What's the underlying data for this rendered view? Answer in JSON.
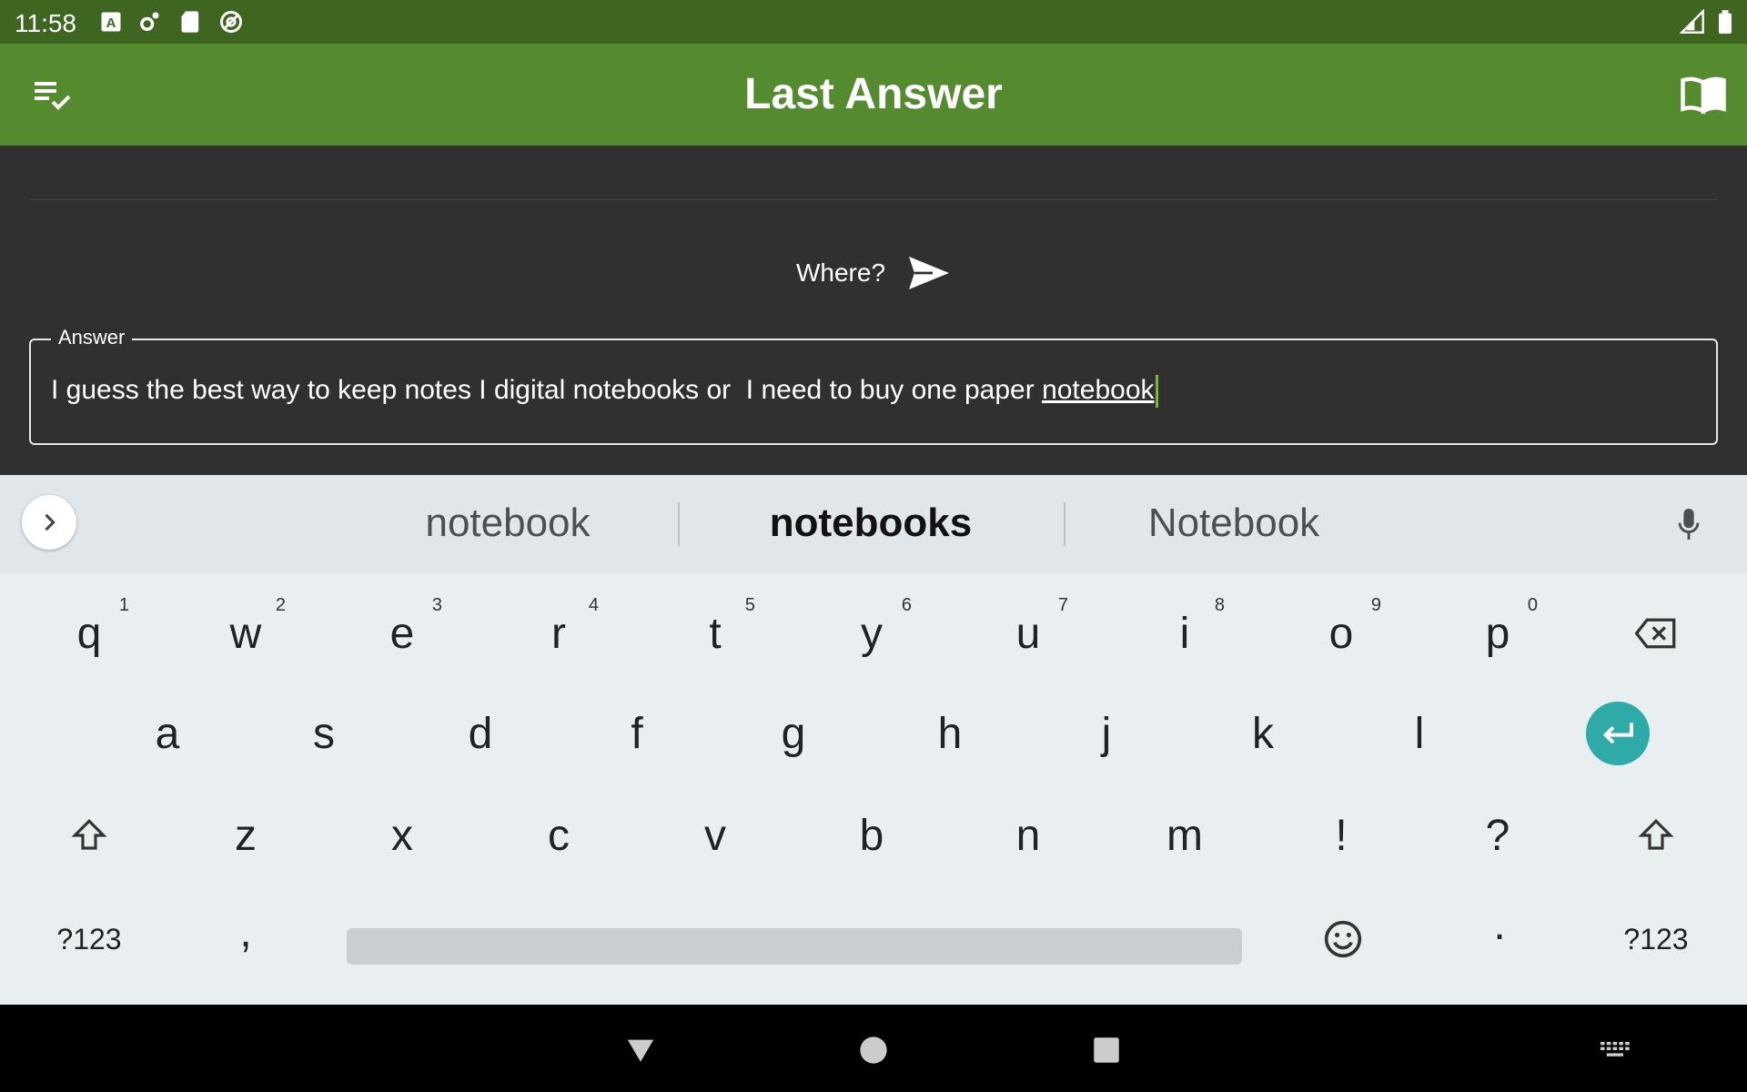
{
  "status_bar": {
    "time": "11:58",
    "icons": [
      "a-box-icon",
      "settings-gear-icon",
      "sd-card-icon",
      "at-sign-icon",
      "signal-icon",
      "battery-icon"
    ]
  },
  "app_bar": {
    "title": "Last Answer",
    "left_icon": "playlist-check-icon",
    "right_icon": "book-icon",
    "background": "#558b2f"
  },
  "content": {
    "question": "Where?",
    "field_label": "Answer",
    "answer_before": "I guess the best way to keep notes I digital notebooks or  I need to buy one paper ",
    "answer_composing": "notebook"
  },
  "keyboard": {
    "suggestions": [
      "notebook",
      "notebooks",
      "Notebook"
    ],
    "row1": [
      {
        "key": "q",
        "hint": "1"
      },
      {
        "key": "w",
        "hint": "2"
      },
      {
        "key": "e",
        "hint": "3"
      },
      {
        "key": "r",
        "hint": "4"
      },
      {
        "key": "t",
        "hint": "5"
      },
      {
        "key": "y",
        "hint": "6"
      },
      {
        "key": "u",
        "hint": "7"
      },
      {
        "key": "i",
        "hint": "8"
      },
      {
        "key": "o",
        "hint": "9"
      },
      {
        "key": "p",
        "hint": "0"
      }
    ],
    "row2": [
      "a",
      "s",
      "d",
      "f",
      "g",
      "h",
      "j",
      "k",
      "l"
    ],
    "row3": [
      "z",
      "x",
      "c",
      "v",
      "b",
      "n",
      "m",
      "!",
      "?"
    ],
    "row4": {
      "symbols_left": "?123",
      "comma": ",",
      "period": ".",
      "symbols_right": "?123"
    },
    "enter_color": "#2eaaa8"
  }
}
